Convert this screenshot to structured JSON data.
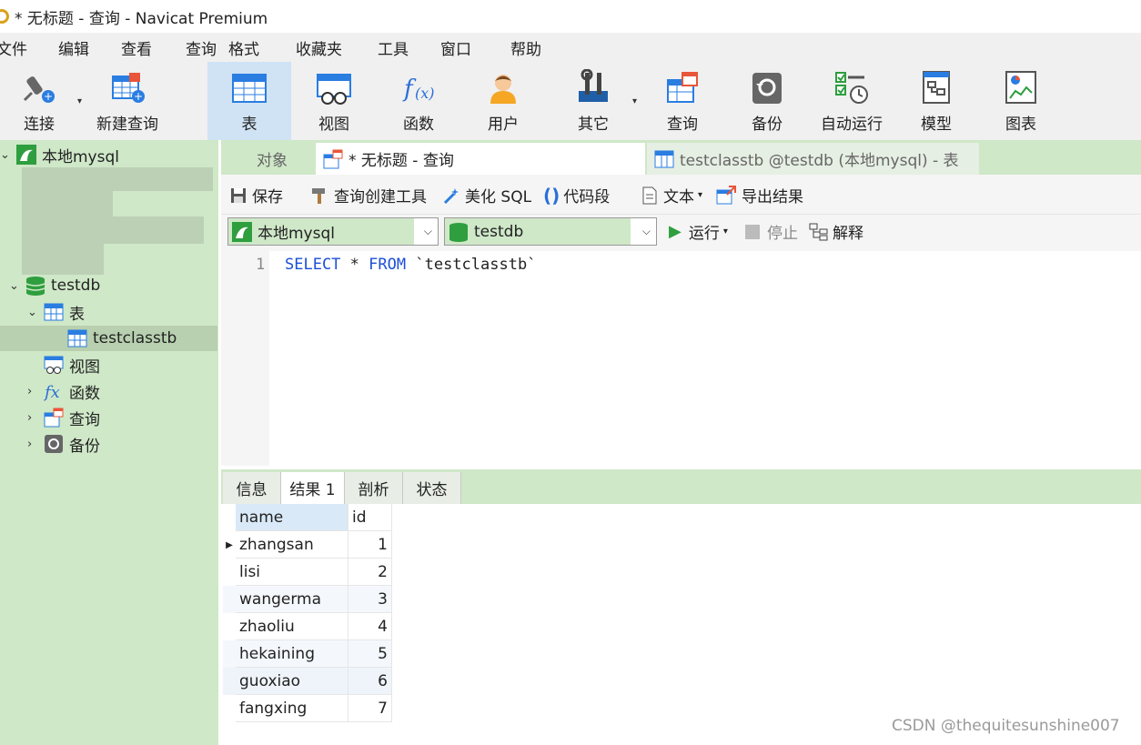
{
  "window": {
    "title": "* 无标题 - 查询 - Navicat Premium"
  },
  "menu": [
    "文件",
    "编辑",
    "查看",
    "查询",
    "格式",
    "收藏夹",
    "工具",
    "窗口",
    "帮助"
  ],
  "toolbar": {
    "items": [
      {
        "label": "连接",
        "icon": "connect-plug-icon"
      },
      {
        "label": "新建查询",
        "icon": "new-query-icon"
      },
      {
        "label": "表",
        "icon": "table-icon",
        "active": true
      },
      {
        "label": "视图",
        "icon": "view-glasses-icon"
      },
      {
        "label": "函数",
        "icon": "function-fx-icon"
      },
      {
        "label": "用户",
        "icon": "user-icon"
      },
      {
        "label": "其它",
        "icon": "tools-icon"
      },
      {
        "label": "查询",
        "icon": "query-icon"
      },
      {
        "label": "备份",
        "icon": "backup-icon"
      },
      {
        "label": "自动运行",
        "icon": "schedule-checklist-icon"
      },
      {
        "label": "模型",
        "icon": "model-icon"
      },
      {
        "label": "图表",
        "icon": "chart-icon"
      }
    ]
  },
  "sidebar": {
    "connection": "本地mysql",
    "database": "testdb",
    "tables_folder": "表",
    "table": "testclasstb",
    "views": "视图",
    "functions": "函数",
    "queries": "查询",
    "backups": "备份"
  },
  "tabs": {
    "objects": "对象",
    "query": "* 无标题 - 查询",
    "table": "testclasstb @testdb (本地mysql) - 表"
  },
  "query_toolbar": {
    "save": "保存",
    "builder": "查询创建工具",
    "beautify": "美化 SQL",
    "snippet": "代码段",
    "text": "文本",
    "export": "导出结果"
  },
  "connbar": {
    "connection": "本地mysql",
    "database": "testdb",
    "run": "运行",
    "stop": "停止",
    "explain": "解释"
  },
  "editor": {
    "line_no": "1",
    "kw_select": "SELECT",
    "star": "*",
    "kw_from": "FROM",
    "table": "`testclasstb`"
  },
  "result_tabs": [
    "信息",
    "结果 1",
    "剖析",
    "状态"
  ],
  "result": {
    "columns": [
      "name",
      "id"
    ],
    "rows": [
      [
        "zhangsan",
        "1"
      ],
      [
        "lisi",
        "2"
      ],
      [
        "wangerma",
        "3"
      ],
      [
        "zhaoliu",
        "4"
      ],
      [
        "hekaining",
        "5"
      ],
      [
        "guoxiao",
        "6"
      ],
      [
        "fangxing",
        "7"
      ]
    ]
  },
  "watermark": "CSDN @thequitesunshine007",
  "colors": {
    "accent_green": "#cfe8c8",
    "selection_blue": "#cfe3f5",
    "keyword_blue": "#1c4fd8"
  }
}
